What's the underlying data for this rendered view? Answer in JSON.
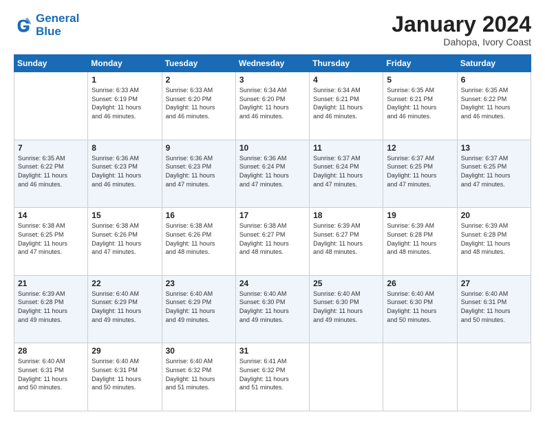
{
  "header": {
    "logo_line1": "General",
    "logo_line2": "Blue",
    "month_year": "January 2024",
    "location": "Dahopa, Ivory Coast"
  },
  "weekdays": [
    "Sunday",
    "Monday",
    "Tuesday",
    "Wednesday",
    "Thursday",
    "Friday",
    "Saturday"
  ],
  "weeks": [
    [
      {
        "day": "",
        "info": ""
      },
      {
        "day": "1",
        "info": "Sunrise: 6:33 AM\nSunset: 6:19 PM\nDaylight: 11 hours\nand 46 minutes."
      },
      {
        "day": "2",
        "info": "Sunrise: 6:33 AM\nSunset: 6:20 PM\nDaylight: 11 hours\nand 46 minutes."
      },
      {
        "day": "3",
        "info": "Sunrise: 6:34 AM\nSunset: 6:20 PM\nDaylight: 11 hours\nand 46 minutes."
      },
      {
        "day": "4",
        "info": "Sunrise: 6:34 AM\nSunset: 6:21 PM\nDaylight: 11 hours\nand 46 minutes."
      },
      {
        "day": "5",
        "info": "Sunrise: 6:35 AM\nSunset: 6:21 PM\nDaylight: 11 hours\nand 46 minutes."
      },
      {
        "day": "6",
        "info": "Sunrise: 6:35 AM\nSunset: 6:22 PM\nDaylight: 11 hours\nand 46 minutes."
      }
    ],
    [
      {
        "day": "7",
        "info": "Sunrise: 6:35 AM\nSunset: 6:22 PM\nDaylight: 11 hours\nand 46 minutes."
      },
      {
        "day": "8",
        "info": "Sunrise: 6:36 AM\nSunset: 6:23 PM\nDaylight: 11 hours\nand 46 minutes."
      },
      {
        "day": "9",
        "info": "Sunrise: 6:36 AM\nSunset: 6:23 PM\nDaylight: 11 hours\nand 47 minutes."
      },
      {
        "day": "10",
        "info": "Sunrise: 6:36 AM\nSunset: 6:24 PM\nDaylight: 11 hours\nand 47 minutes."
      },
      {
        "day": "11",
        "info": "Sunrise: 6:37 AM\nSunset: 6:24 PM\nDaylight: 11 hours\nand 47 minutes."
      },
      {
        "day": "12",
        "info": "Sunrise: 6:37 AM\nSunset: 6:25 PM\nDaylight: 11 hours\nand 47 minutes."
      },
      {
        "day": "13",
        "info": "Sunrise: 6:37 AM\nSunset: 6:25 PM\nDaylight: 11 hours\nand 47 minutes."
      }
    ],
    [
      {
        "day": "14",
        "info": "Sunrise: 6:38 AM\nSunset: 6:25 PM\nDaylight: 11 hours\nand 47 minutes."
      },
      {
        "day": "15",
        "info": "Sunrise: 6:38 AM\nSunset: 6:26 PM\nDaylight: 11 hours\nand 47 minutes."
      },
      {
        "day": "16",
        "info": "Sunrise: 6:38 AM\nSunset: 6:26 PM\nDaylight: 11 hours\nand 48 minutes."
      },
      {
        "day": "17",
        "info": "Sunrise: 6:38 AM\nSunset: 6:27 PM\nDaylight: 11 hours\nand 48 minutes."
      },
      {
        "day": "18",
        "info": "Sunrise: 6:39 AM\nSunset: 6:27 PM\nDaylight: 11 hours\nand 48 minutes."
      },
      {
        "day": "19",
        "info": "Sunrise: 6:39 AM\nSunset: 6:28 PM\nDaylight: 11 hours\nand 48 minutes."
      },
      {
        "day": "20",
        "info": "Sunrise: 6:39 AM\nSunset: 6:28 PM\nDaylight: 11 hours\nand 48 minutes."
      }
    ],
    [
      {
        "day": "21",
        "info": "Sunrise: 6:39 AM\nSunset: 6:28 PM\nDaylight: 11 hours\nand 49 minutes."
      },
      {
        "day": "22",
        "info": "Sunrise: 6:40 AM\nSunset: 6:29 PM\nDaylight: 11 hours\nand 49 minutes."
      },
      {
        "day": "23",
        "info": "Sunrise: 6:40 AM\nSunset: 6:29 PM\nDaylight: 11 hours\nand 49 minutes."
      },
      {
        "day": "24",
        "info": "Sunrise: 6:40 AM\nSunset: 6:30 PM\nDaylight: 11 hours\nand 49 minutes."
      },
      {
        "day": "25",
        "info": "Sunrise: 6:40 AM\nSunset: 6:30 PM\nDaylight: 11 hours\nand 49 minutes."
      },
      {
        "day": "26",
        "info": "Sunrise: 6:40 AM\nSunset: 6:30 PM\nDaylight: 11 hours\nand 50 minutes."
      },
      {
        "day": "27",
        "info": "Sunrise: 6:40 AM\nSunset: 6:31 PM\nDaylight: 11 hours\nand 50 minutes."
      }
    ],
    [
      {
        "day": "28",
        "info": "Sunrise: 6:40 AM\nSunset: 6:31 PM\nDaylight: 11 hours\nand 50 minutes."
      },
      {
        "day": "29",
        "info": "Sunrise: 6:40 AM\nSunset: 6:31 PM\nDaylight: 11 hours\nand 50 minutes."
      },
      {
        "day": "30",
        "info": "Sunrise: 6:40 AM\nSunset: 6:32 PM\nDaylight: 11 hours\nand 51 minutes."
      },
      {
        "day": "31",
        "info": "Sunrise: 6:41 AM\nSunset: 6:32 PM\nDaylight: 11 hours\nand 51 minutes."
      },
      {
        "day": "",
        "info": ""
      },
      {
        "day": "",
        "info": ""
      },
      {
        "day": "",
        "info": ""
      }
    ]
  ]
}
